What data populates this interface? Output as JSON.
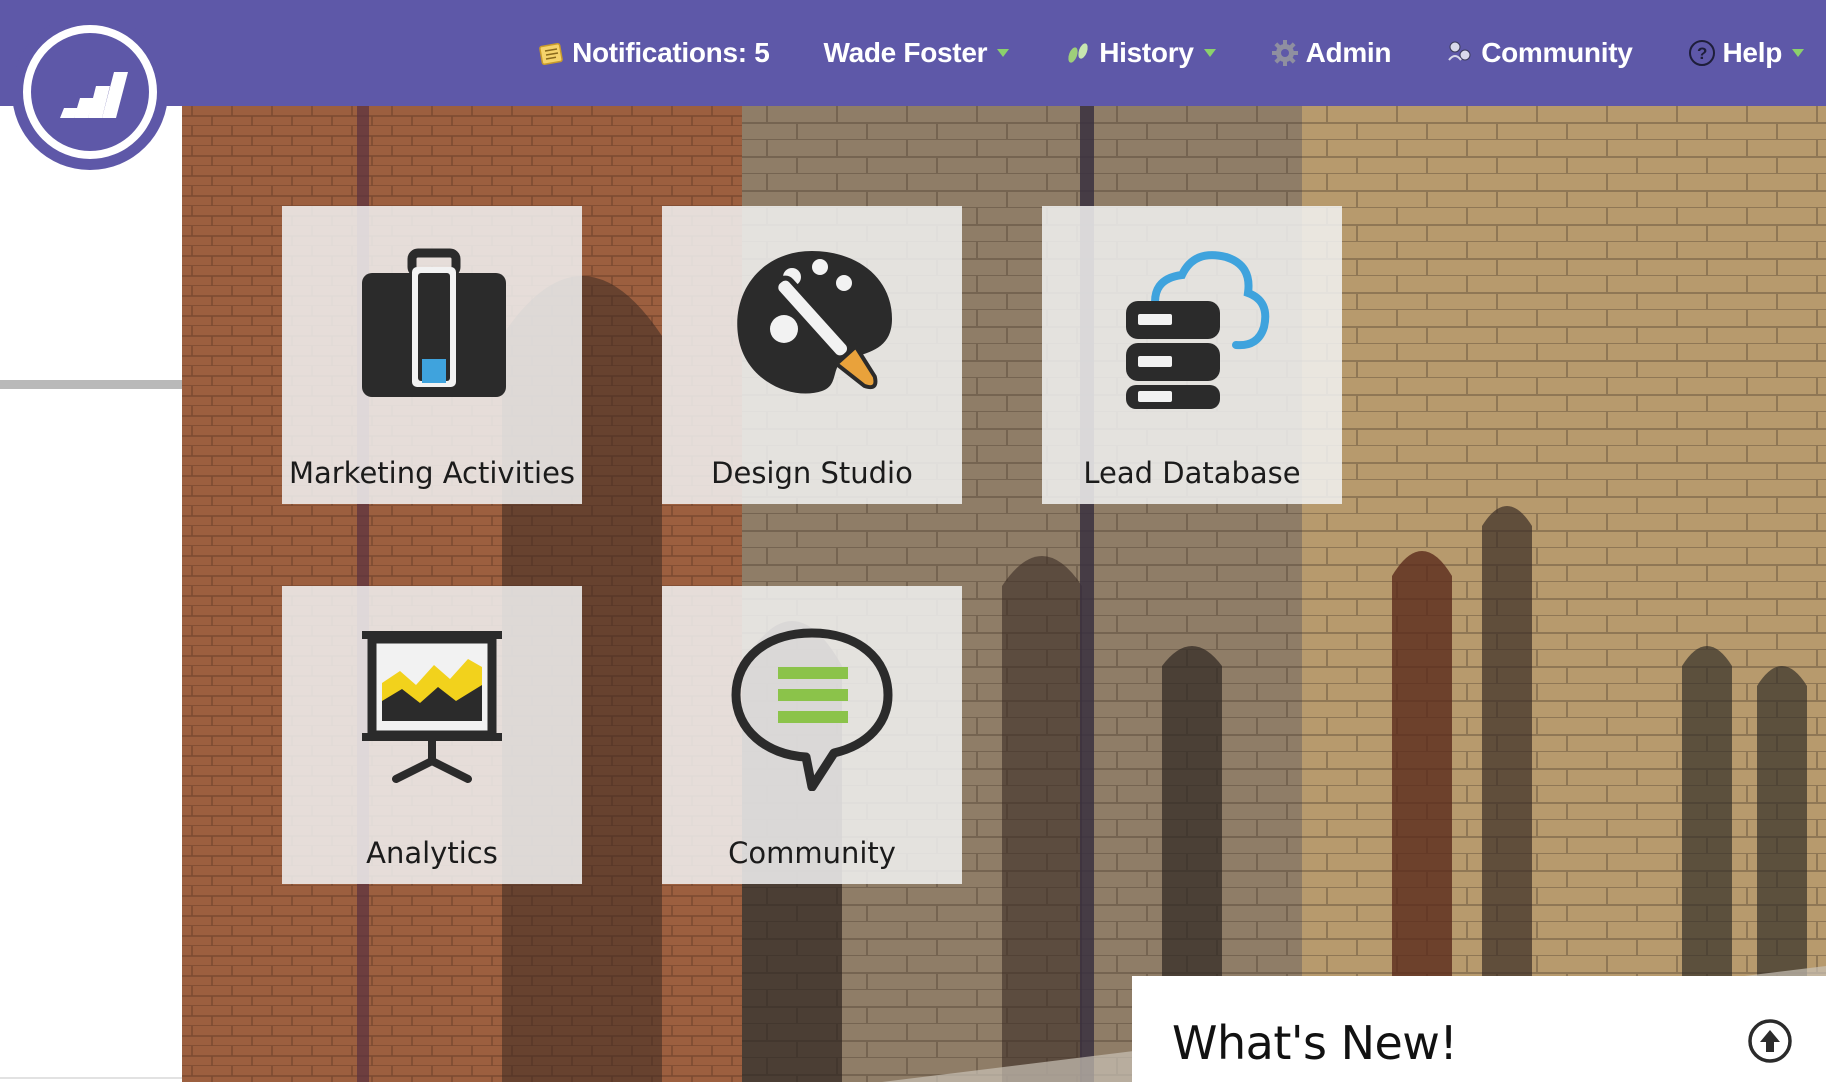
{
  "header": {
    "nav": {
      "notifications": "Notifications: 5",
      "user": "Wade Foster",
      "history": "History",
      "admin": "Admin",
      "community": "Community",
      "help": "Help"
    }
  },
  "tiles": [
    {
      "label": "Marketing Activities",
      "icon": "briefcase-icon"
    },
    {
      "label": "Design Studio",
      "icon": "palette-icon"
    },
    {
      "label": "Lead Database",
      "icon": "database-cloud-icon"
    },
    {
      "label": "Analytics",
      "icon": "presentation-chart-icon"
    },
    {
      "label": "Community",
      "icon": "speech-bubble-icon"
    }
  ],
  "whats_new": {
    "title": "What's New!"
  },
  "colors": {
    "brand": "#5e58a8",
    "accent_blue": "#3fa3dd",
    "accent_yellow": "#f2d21c",
    "accent_green": "#8bc34a",
    "accent_orange": "#e9a23b"
  }
}
